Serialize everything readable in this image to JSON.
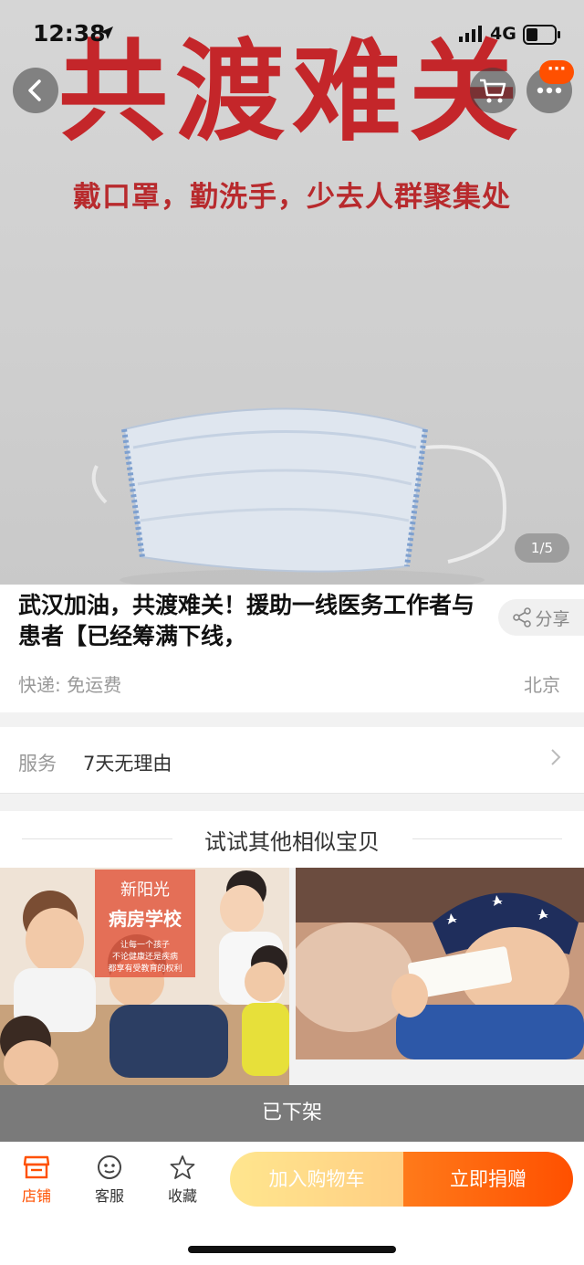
{
  "status_bar": {
    "time": "12:38",
    "network": "4G"
  },
  "hero": {
    "title": "共渡难关",
    "subtitle": "戴口罩，勤洗手，少去人群聚集处",
    "counter": "1/5",
    "more_badge": "···"
  },
  "product": {
    "title": "武汉加油，共渡难关！援助一线医务工作者与患者【已经筹满下线，",
    "share_label": "分享",
    "shipping": "快递: 免运费",
    "location": "北京"
  },
  "service": {
    "label": "服务",
    "value": "7天无理由"
  },
  "similar": {
    "title": "试试其他相似宝贝",
    "card1": {
      "logo": "新阳光",
      "name": "病房学校",
      "text_line1": "让每一个孩子",
      "text_line2": "不论健康还是疾病",
      "text_line3": "都享有受教育的权利"
    }
  },
  "off_shelf": "已下架",
  "bottom_bar": {
    "shop": "店铺",
    "customer_service": "客服",
    "favorite": "收藏",
    "add_to_cart": "加入购物车",
    "donate_now": "立即捐赠"
  },
  "colors": {
    "accent": "#ff5000",
    "hero_red": "#c4262a"
  }
}
